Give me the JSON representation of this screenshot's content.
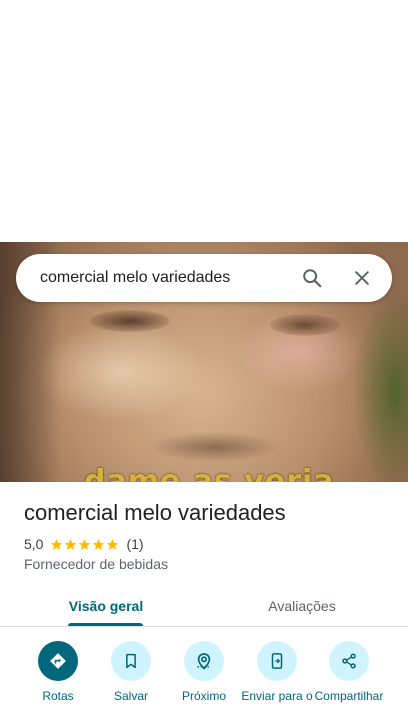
{
  "search": {
    "query": "comercial melo variedades"
  },
  "hero": {
    "caption": "dame as veria"
  },
  "place": {
    "name": "comercial melo variedades",
    "rating": "5,0",
    "rating_stars": 5,
    "review_count": "(1)",
    "category": "Fornecedor de bebidas"
  },
  "tabs": [
    {
      "label": "Visão geral",
      "selected": true
    },
    {
      "label": "Avaliações",
      "selected": false
    }
  ],
  "actions": [
    {
      "label": "Rotas",
      "icon": "directions-icon"
    },
    {
      "label": "Salvar",
      "icon": "bookmark-icon"
    },
    {
      "label": "Próximo",
      "icon": "nearby-icon"
    },
    {
      "label": "Enviar para o",
      "icon": "send-to-phone-icon"
    },
    {
      "label": "Compartilhar",
      "icon": "share-icon"
    }
  ],
  "colors": {
    "accent": "#00677d",
    "accent_light": "#d0f4ff",
    "star": "#fbbc04"
  }
}
